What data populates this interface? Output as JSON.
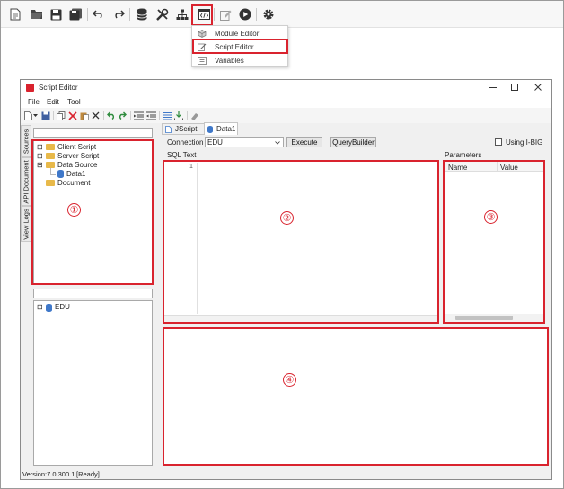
{
  "menu": {
    "items": [
      {
        "label": "Module Editor",
        "icon": "cube-icon"
      },
      {
        "label": "Script Editor",
        "icon": "pencil-ruler-icon"
      },
      {
        "label": "Variables",
        "icon": "variable-icon"
      }
    ]
  },
  "window": {
    "title": "Script Editor",
    "menubar": [
      "File",
      "Edit",
      "Tool"
    ],
    "side_tabs": [
      "Sources",
      "API Document",
      "View Logs"
    ],
    "tree": {
      "items": [
        "Client Script",
        "Server Script",
        "Data Source",
        "Data1",
        "Document"
      ]
    },
    "tree2": {
      "items": [
        "EDU"
      ]
    },
    "doc_tabs": [
      "JScript",
      "Data1"
    ],
    "connection": {
      "label": "Connection",
      "value": "EDU",
      "execute_label": "Execute",
      "querybuilder_label": "QueryBuilder",
      "using_ibig_label": "Using I-BIG"
    },
    "sql_text_label": "SQL Text",
    "line_number": "1",
    "parameters": {
      "label": "Parameters",
      "columns": [
        "Name",
        "Value"
      ]
    },
    "status": {
      "version": "Version:7.0.300.1",
      "state": "[Ready]"
    }
  },
  "callouts": [
    "①",
    "②",
    "③",
    "④"
  ],
  "colors": {
    "highlight": "#d9232e",
    "folder": "#e8b94a",
    "db": "#3f78c9"
  }
}
